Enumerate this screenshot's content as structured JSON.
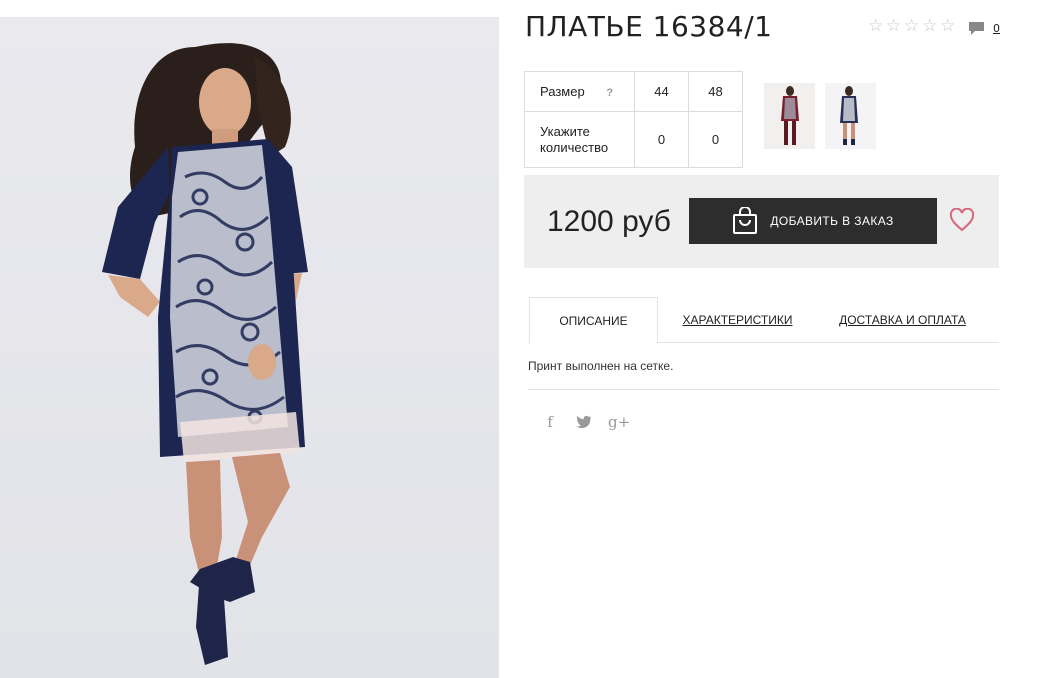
{
  "product": {
    "title": "ПЛАТЬЕ 16384/1",
    "rating_stars": 0,
    "rating_max": 5,
    "comments_count": "0"
  },
  "sizes": {
    "size_label": "Размер",
    "help_glyph": "?",
    "quantity_label_1": "Укажите",
    "quantity_label_2": "количество",
    "columns": [
      "44",
      "48"
    ],
    "quantities": [
      "0",
      "0"
    ]
  },
  "purchase": {
    "price": "1200 руб",
    "add_button_label": "ДОБАВИТЬ В ЗАКАЗ"
  },
  "tabs": [
    {
      "label": "ОПИСАНИЕ",
      "active": true
    },
    {
      "label": "ХАРАКТЕРИСТИКИ",
      "active": false
    },
    {
      "label": "ДОСТАВКА И ОПЛАТА",
      "active": false
    }
  ],
  "description": "Принт выполнен на сетке.",
  "social": {
    "facebook": "f",
    "twitter": "t",
    "google_plus": "g+"
  },
  "colors": {
    "button_bg": "#2d2d2d",
    "price_panel_bg": "#eeeeee",
    "heart": "#d9667d",
    "dress_navy": "#1c2650"
  },
  "icons": [
    "star-icon",
    "comment-icon",
    "help-icon",
    "shopping-bag-icon",
    "heart-icon",
    "facebook-icon",
    "twitter-icon",
    "google-plus-icon"
  ]
}
